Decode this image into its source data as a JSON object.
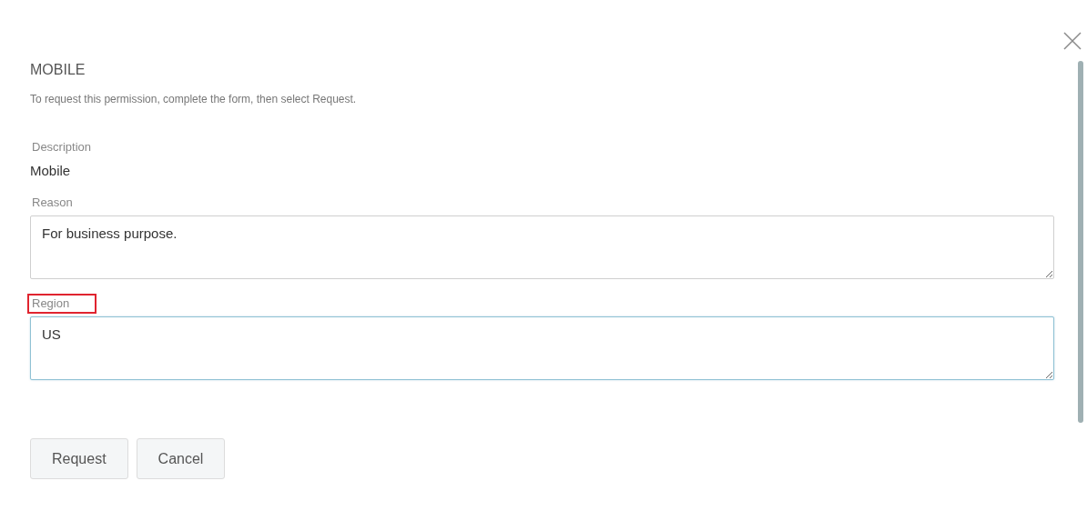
{
  "dialog": {
    "title": "MOBILE",
    "instruction": "To request this permission, complete the form, then select Request."
  },
  "fields": [
    {
      "kind": "readonly",
      "label": "Description",
      "value": "Mobile"
    },
    {
      "kind": "textarea",
      "label": "Reason",
      "value": "For business purpose.",
      "focused": false,
      "highlighted": false
    },
    {
      "kind": "textarea",
      "label": "Region",
      "value": "US",
      "focused": true,
      "highlighted": true
    }
  ],
  "buttons": [
    "Request",
    "Cancel"
  ]
}
